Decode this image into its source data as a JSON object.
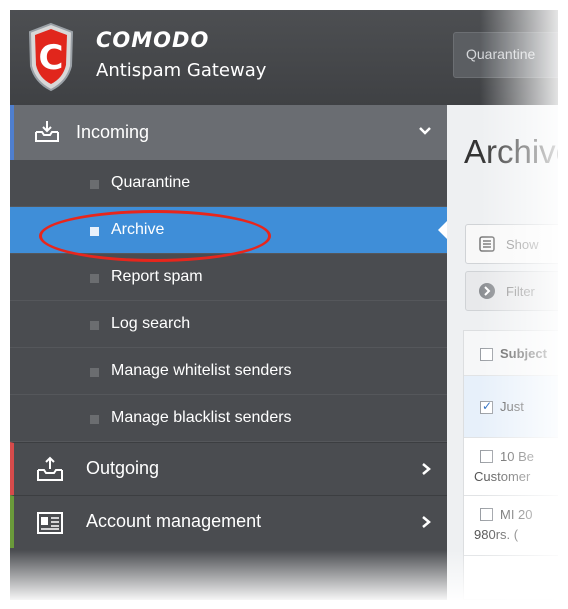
{
  "header": {
    "brand": "COMODO",
    "product": "Antispam Gateway",
    "top_tab": "Quarantine"
  },
  "sidebar": {
    "incoming": {
      "label": "Incoming",
      "icon": "inbox-tray-icon"
    },
    "sub_items": [
      {
        "label": "Quarantine",
        "active": false
      },
      {
        "label": "Archive",
        "active": true
      },
      {
        "label": "Report spam",
        "active": false
      },
      {
        "label": "Log search",
        "active": false
      },
      {
        "label": "Manage whitelist senders",
        "active": false
      },
      {
        "label": "Manage blacklist senders",
        "active": false
      }
    ],
    "outgoing": {
      "label": "Outgoing",
      "icon": "outbox-tray-icon"
    },
    "account": {
      "label": "Account management",
      "icon": "account-card-icon"
    }
  },
  "content": {
    "title": "Archive",
    "show_button": "Show",
    "filter_button": "Filter",
    "table": {
      "header": "Subject",
      "rows": [
        {
          "line1": "Just",
          "line2": "",
          "checked": true
        },
        {
          "line1": "10 Be",
          "line2": "Customer",
          "checked": false
        },
        {
          "line1": "MI 20",
          "line2": "980rs. (",
          "checked": false
        }
      ]
    }
  },
  "colors": {
    "active_blue": "#3f8ed8",
    "highlight_red": "#e8261c",
    "incoming_accent": "#4f7fcf",
    "outgoing_accent": "#d64b4b",
    "account_accent": "#6a9a3a"
  }
}
